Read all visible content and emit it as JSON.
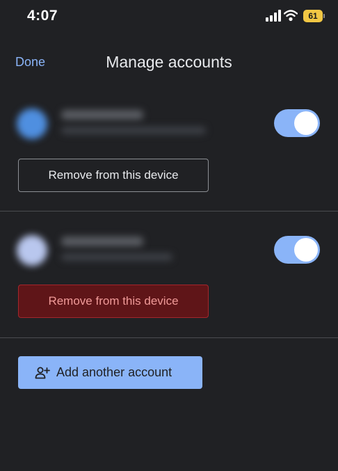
{
  "status_bar": {
    "time": "4:07",
    "battery": "61",
    "signal_icon": "cellular-signal-icon",
    "wifi_icon": "wifi-icon"
  },
  "header": {
    "done_label": "Done",
    "title": "Manage accounts"
  },
  "accounts": [
    {
      "sync_enabled": true,
      "remove_label": "Remove from this device",
      "remove_state": "default"
    },
    {
      "sync_enabled": true,
      "remove_label": "Remove from this device",
      "remove_state": "pressed"
    }
  ],
  "footer": {
    "add_label": "Add another account",
    "add_icon": "person-add-icon"
  },
  "colors": {
    "background": "#202124",
    "accent": "#8ab4f8",
    "danger_bg": "#5f1518",
    "danger_text": "#f09a98"
  }
}
